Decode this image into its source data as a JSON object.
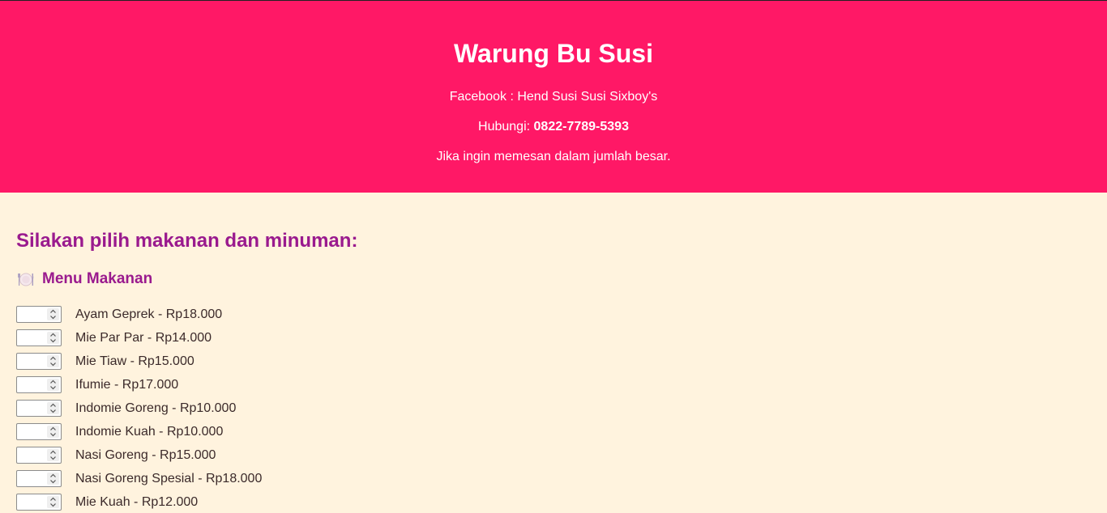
{
  "header": {
    "title": "Warung Bu Susi",
    "facebook": "Facebook : Hend Susi Susi Sixboy's",
    "contact_prefix": "Hubungi: ",
    "contact_phone": "0822-7789-5393",
    "bulk_note": "Jika ingin memesan dalam jumlah besar."
  },
  "main": {
    "heading": "Silakan pilih makanan dan minuman:",
    "food_section": {
      "icon": "plate-cutlery-icon",
      "title": "Menu Makanan",
      "items": [
        {
          "label": "Ayam Geprek - Rp18.000",
          "quantity": ""
        },
        {
          "label": "Mie Par Par - Rp14.000",
          "quantity": ""
        },
        {
          "label": "Mie Tiaw - Rp15.000",
          "quantity": ""
        },
        {
          "label": "Ifumie - Rp17.000",
          "quantity": ""
        },
        {
          "label": "Indomie Goreng - Rp10.000",
          "quantity": ""
        },
        {
          "label": "Indomie Kuah - Rp10.000",
          "quantity": ""
        },
        {
          "label": "Nasi Goreng - Rp15.000",
          "quantity": ""
        },
        {
          "label": "Nasi Goreng Spesial - Rp18.000",
          "quantity": ""
        },
        {
          "label": "Mie Kuah - Rp12.000",
          "quantity": ""
        }
      ]
    }
  },
  "colors": {
    "header_bg": "#ff1866",
    "page_bg": "#fff3de",
    "heading": "#9a1a8e"
  }
}
